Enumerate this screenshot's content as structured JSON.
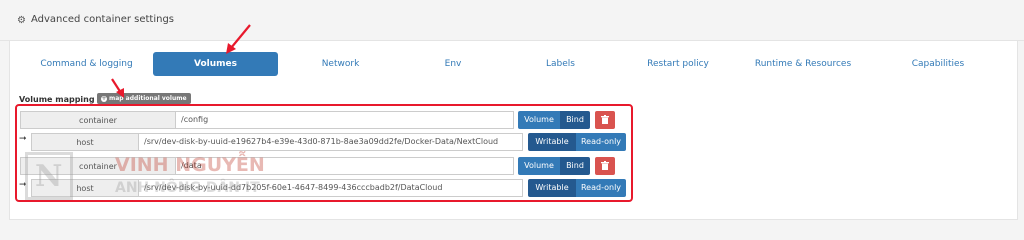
{
  "header": {
    "title": "Advanced container settings",
    "icon": "gear-icon"
  },
  "tabs": [
    {
      "label": "Command & logging",
      "active": false
    },
    {
      "label": "Volumes",
      "active": true
    },
    {
      "label": "Network",
      "active": false
    },
    {
      "label": "Env",
      "active": false
    },
    {
      "label": "Labels",
      "active": false
    },
    {
      "label": "Restart policy",
      "active": false
    },
    {
      "label": "Runtime & Resources",
      "active": false
    },
    {
      "label": "Capabilities",
      "active": false
    }
  ],
  "volume_mapping": {
    "label": "Volume mapping",
    "map_button": "map additional volume",
    "volumes": [
      {
        "container_label": "container",
        "container_path": "/config",
        "type_volume": "Volume",
        "type_bind": "Bind",
        "host_label": "host",
        "host_path": "/srv/dev-disk-by-uuid-e19627b4-e39e-43d0-871b-8ae3a09dd2fe/Docker-Data/NextCloud",
        "mode_writable": "Writable",
        "mode_readonly": "Read-only"
      },
      {
        "container_label": "container",
        "container_path": "/data",
        "type_volume": "Volume",
        "type_bind": "Bind",
        "host_label": "host",
        "host_path": "/srv/dev-disk-by-uuid-dd7b205f-60e1-4647-8499-436cccbadb2f/DataCloud",
        "mode_writable": "Writable",
        "mode_readonly": "Read-only"
      }
    ]
  },
  "watermark": {
    "line1": "VINH NGUYỄN",
    "line2": "ANH NÔNG DÂN IT",
    "logo": "N"
  },
  "colors": {
    "accent": "#337ab7",
    "accent_dark": "#24598f",
    "danger": "#d9534f",
    "highlight": "#e8192c"
  }
}
